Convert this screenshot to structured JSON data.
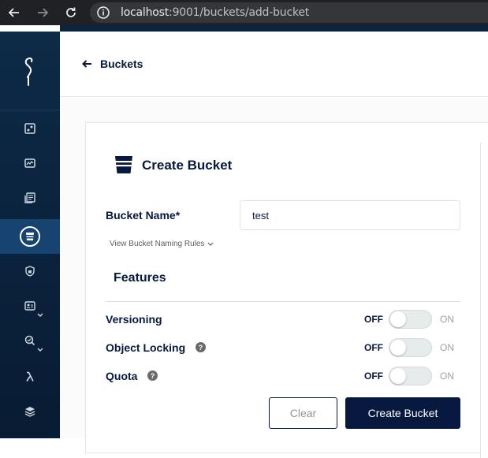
{
  "browser": {
    "url_host": "localhost",
    "url_path": ":9001/buckets/add-bucket"
  },
  "header": {
    "back_label": "Buckets"
  },
  "form": {
    "title": "Create Bucket",
    "bucket_name_label": "Bucket Name*",
    "bucket_name_value": "test",
    "naming_rules_link": "View Bucket Naming Rules",
    "features_title": "Features",
    "features": [
      {
        "label": "Versioning",
        "off_label": "OFF",
        "on_label": "ON",
        "enabled": false
      },
      {
        "label": "Object Locking",
        "off_label": "OFF",
        "on_label": "ON",
        "enabled": false
      },
      {
        "label": "Quota",
        "off_label": "OFF",
        "on_label": "ON",
        "enabled": false
      }
    ],
    "clear_label": "Clear",
    "create_label": "Create Bucket"
  },
  "colors": {
    "sidebar": "#0d2a47",
    "sidebar_active": "#16436f",
    "primary": "#07193e"
  },
  "sidebar": {
    "items": [
      {
        "icon": "dashboard-icon"
      },
      {
        "icon": "monitoring-icon"
      },
      {
        "icon": "logs-icon"
      },
      {
        "icon": "buckets-icon",
        "active": true
      },
      {
        "icon": "policies-icon"
      },
      {
        "icon": "identity-icon",
        "expandable": true
      },
      {
        "icon": "access-icon",
        "expandable": true
      },
      {
        "icon": "lambda-icon"
      },
      {
        "icon": "tiers-icon"
      }
    ]
  }
}
